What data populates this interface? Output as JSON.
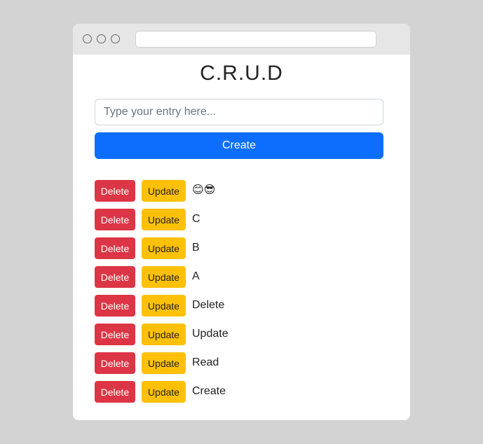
{
  "app": {
    "title": "C.R.U.D"
  },
  "input": {
    "value": "",
    "placeholder": "Type your entry here..."
  },
  "create_button": {
    "label": "Create",
    "color": "#0d6efd"
  },
  "items": [
    {
      "text": "😊😎",
      "delete_label": "Delete",
      "update_label": "Update"
    },
    {
      "text": "C",
      "delete_label": "Delete",
      "update_label": "Update"
    },
    {
      "text": "B",
      "delete_label": "Delete",
      "update_label": "Update"
    },
    {
      "text": "A",
      "delete_label": "Delete",
      "update_label": "Update"
    },
    {
      "text": "Delete",
      "delete_label": "Delete",
      "update_label": "Update"
    },
    {
      "text": "Update",
      "delete_label": "Delete",
      "update_label": "Update"
    },
    {
      "text": "Read",
      "delete_label": "Delete",
      "update_label": "Update"
    },
    {
      "text": "Create",
      "delete_label": "Delete",
      "update_label": "Update"
    }
  ],
  "colors": {
    "delete": "#dc3545",
    "update": "#ffc107",
    "background": "#d3d3d3"
  }
}
